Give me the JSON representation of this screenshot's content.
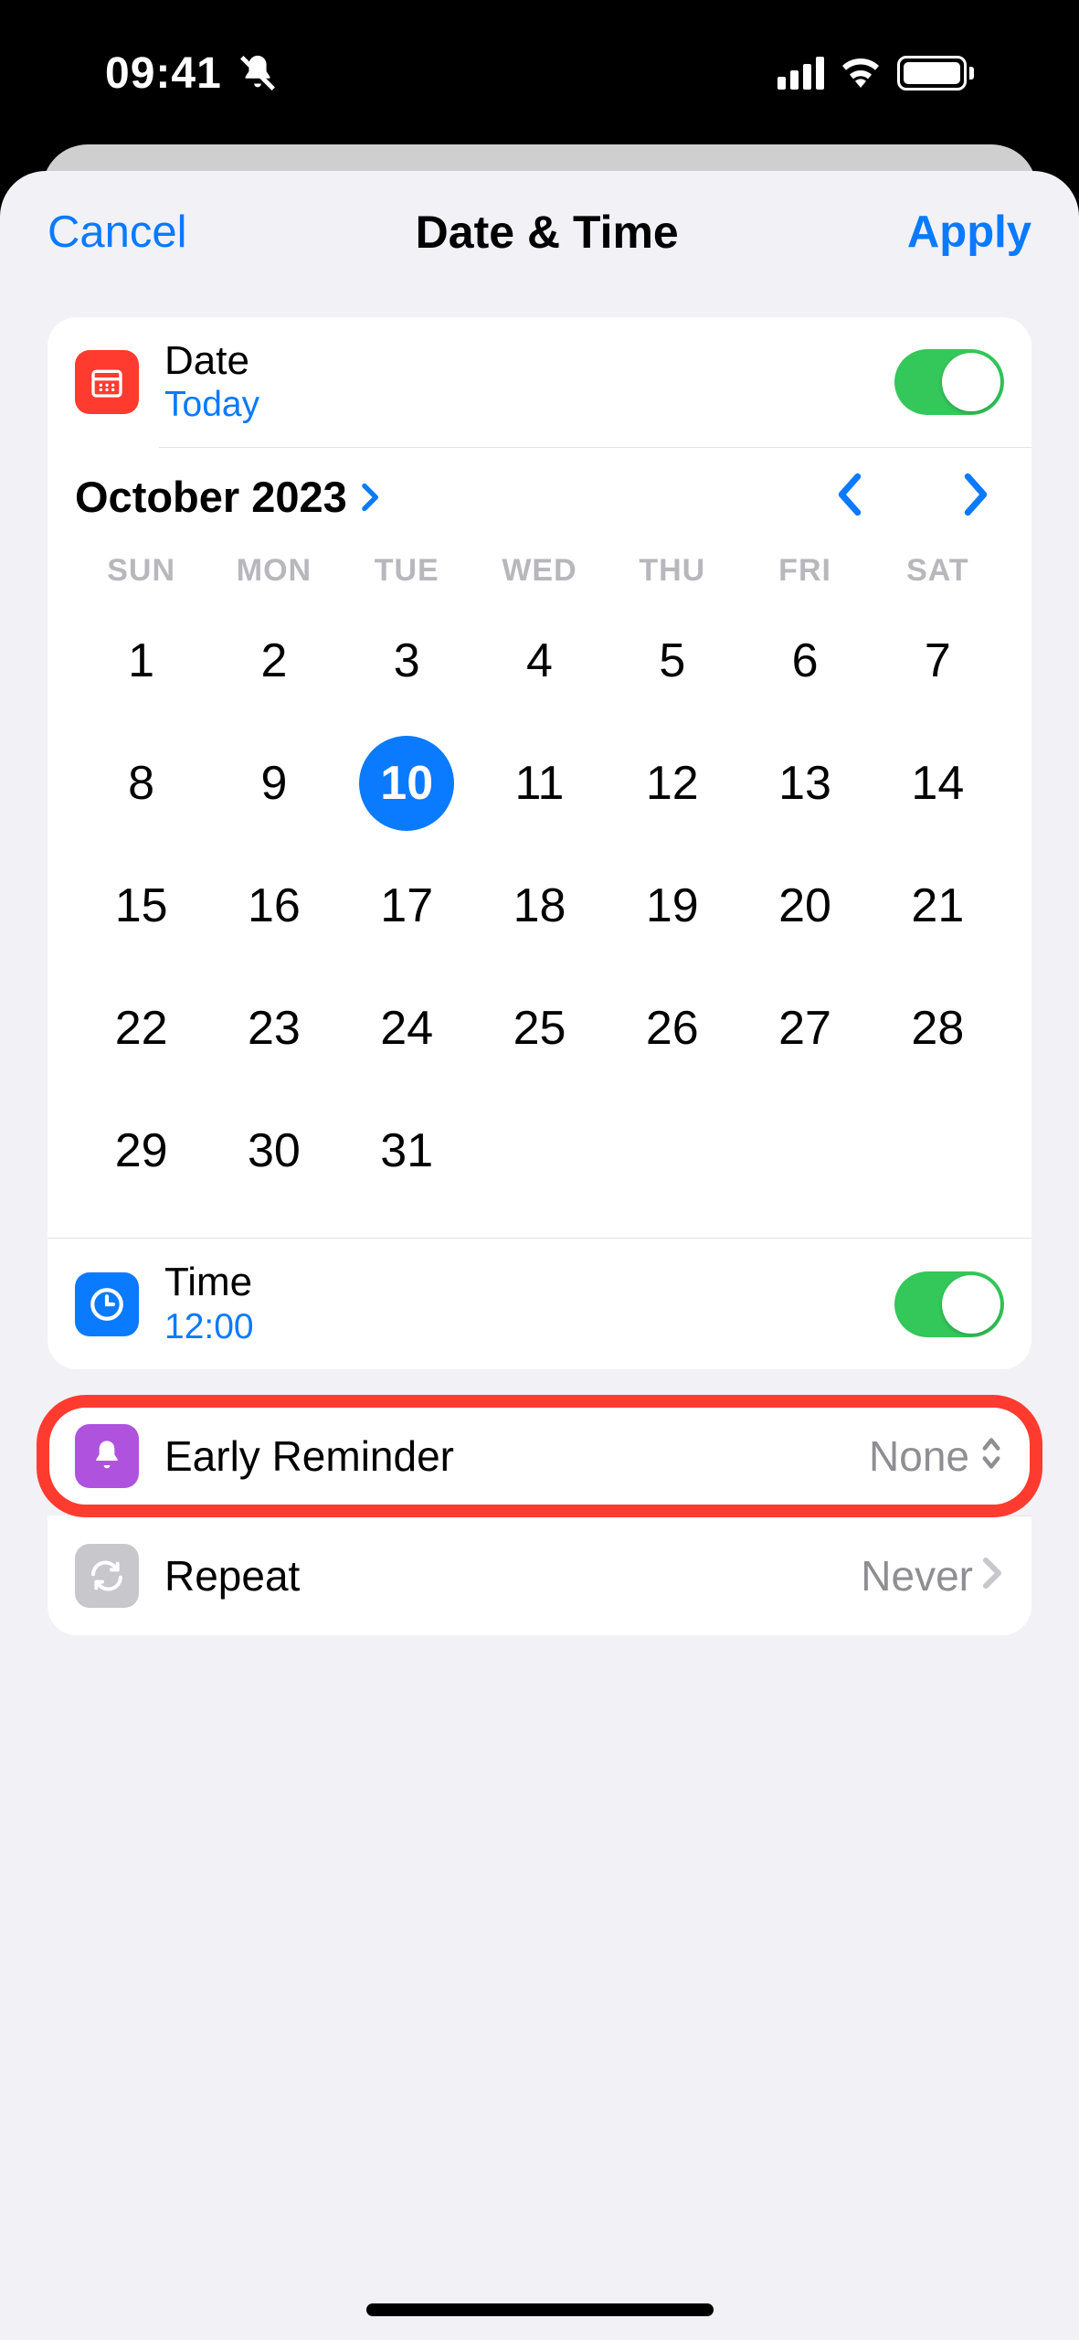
{
  "status": {
    "time": "09:41"
  },
  "nav": {
    "cancel": "Cancel",
    "title": "Date & Time",
    "apply": "Apply"
  },
  "date_row": {
    "title": "Date",
    "sub": "Today",
    "toggle": true
  },
  "calendar": {
    "month_label": "October 2023",
    "weekdays": [
      "SUN",
      "MON",
      "TUE",
      "WED",
      "THU",
      "FRI",
      "SAT"
    ],
    "weeks": [
      [
        "1",
        "2",
        "3",
        "4",
        "5",
        "6",
        "7"
      ],
      [
        "8",
        "9",
        "10",
        "11",
        "12",
        "13",
        "14"
      ],
      [
        "15",
        "16",
        "17",
        "18",
        "19",
        "20",
        "21"
      ],
      [
        "22",
        "23",
        "24",
        "25",
        "26",
        "27",
        "28"
      ],
      [
        "29",
        "30",
        "31",
        "",
        "",
        "",
        ""
      ]
    ],
    "selected": "10"
  },
  "time_row": {
    "title": "Time",
    "sub": "12:00",
    "toggle": true
  },
  "early_reminder": {
    "label": "Early Reminder",
    "value": "None"
  },
  "repeat": {
    "label": "Repeat",
    "value": "Never"
  }
}
